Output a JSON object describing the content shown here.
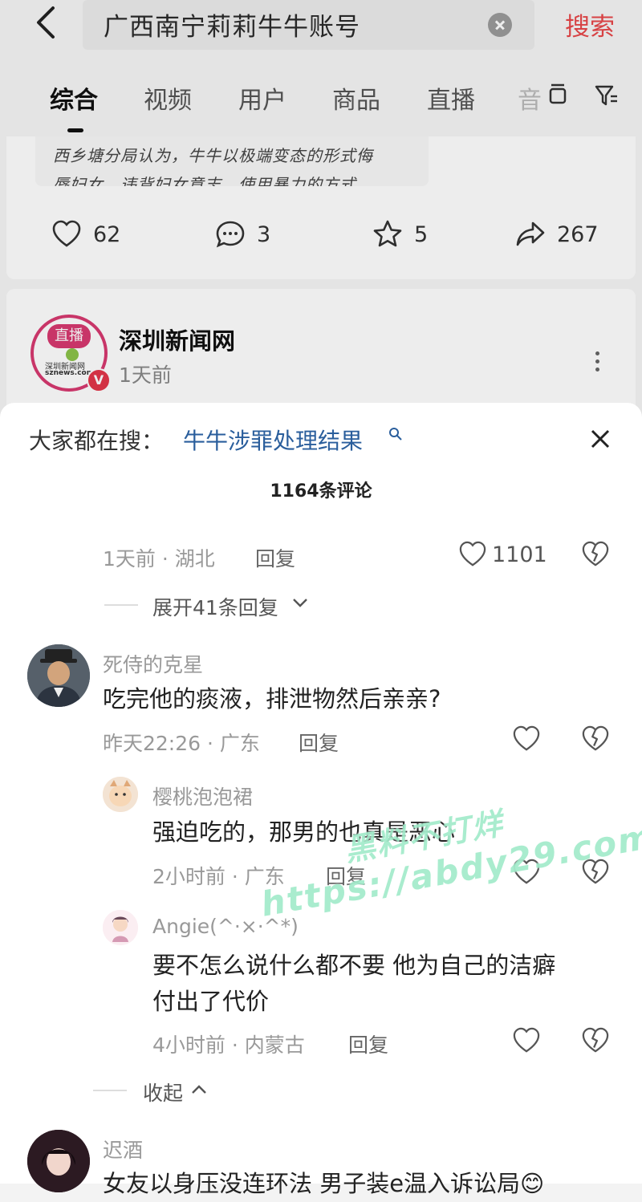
{
  "header": {
    "query": "广西南宁莉莉牛牛账号",
    "search_label": "搜索"
  },
  "tabs": [
    {
      "label": "综合"
    },
    {
      "label": "视频"
    },
    {
      "label": "用户"
    },
    {
      "label": "商品"
    },
    {
      "label": "直播"
    },
    {
      "label": "音"
    }
  ],
  "post1": {
    "quote_line1": "西乡塘分局认为，牛牛以极端变态的形式侮",
    "quote_line2": "辱妇女，违背妇女意志，使用暴力的方式",
    "likes": "62",
    "comments": "3",
    "favorites": "5",
    "shares": "267"
  },
  "post2": {
    "author": "深圳新闻网",
    "time": "1天前",
    "live_badge": "直播",
    "brand_cn": "深圳新闻网",
    "brand_en": "sznews.com",
    "verified_mark": "V"
  },
  "sheet": {
    "trending_label": "大家都在搜：",
    "trending_link": "牛牛涉罪处理结果",
    "comment_count": "1164条评论",
    "c0": {
      "meta": "1天前 · 湖北",
      "reply": "回复",
      "likes": "1101"
    },
    "expand_label": "展开41条回复",
    "c1": {
      "user": "死侍的克星",
      "text": "吃完他的痰液，排泄物然后亲亲?",
      "meta": "昨天22:26 · 广东",
      "reply": "回复"
    },
    "r1": {
      "user": "樱桃泡泡裙",
      "text": "强迫吃的，那男的也真是恶心",
      "meta": "2小时前 · 广东",
      "reply": "回复"
    },
    "r2": {
      "user": "Angie(^·×·^*)",
      "text_line1": "要不怎么说什么都不要 他为自己的洁癖",
      "text_line2": "付出了代价",
      "meta": "4小时前 · 内蒙古",
      "reply": "回复"
    },
    "collapse_label": "收起",
    "c2": {
      "user": "迟酒",
      "text": "女友以身压没连环法 男子装e温入诉讼局😊"
    }
  },
  "watermark": {
    "line1": "黑料不打烊",
    "line2": "https://abdy29.com"
  }
}
